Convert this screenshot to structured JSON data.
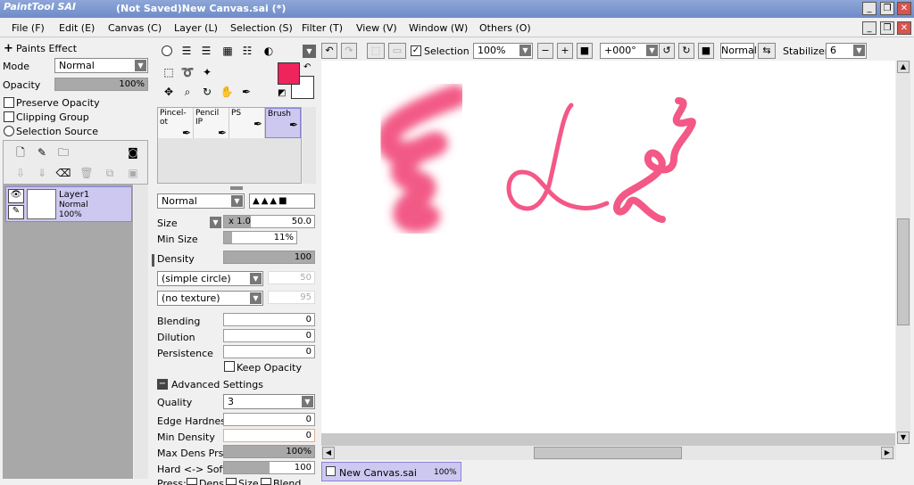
{
  "app": {
    "logo": "PaintTool SAI",
    "title": "(Not Saved)New Canvas.sai (*)"
  },
  "window": {
    "minimize": "_",
    "restore": "❐",
    "close": "✕"
  },
  "menu": [
    "File (F)",
    "Edit (E)",
    "Canvas (C)",
    "Layer (L)",
    "Selection (S)",
    "Filter (T)",
    "View (V)",
    "Window (W)",
    "Others (O)"
  ],
  "layer_panel": {
    "paints_effect": "Paints Effect",
    "mode_label": "Mode",
    "mode_value": "Normal",
    "opacity_label": "Opacity",
    "opacity_value": "100%",
    "opacity_fill": 1.0,
    "preserve_opacity": "Preserve Opacity",
    "clipping_group": "Clipping Group",
    "selection_source": "Selection Source",
    "layer": {
      "name": "Layer1",
      "mode": "Normal",
      "opacity": "100%"
    }
  },
  "tool_panel": {
    "tools": [
      "Pincel-ot",
      "Pencil IP",
      "PS",
      "Brush"
    ],
    "blend_mode": "Normal",
    "size_label": "Size",
    "size_mult": "x 1.0",
    "size_value": "50.0",
    "min_size_label": "Min Size",
    "min_size_value": "11%",
    "min_size_fill": 0.11,
    "density_label": "Density",
    "density_value": "100",
    "density_fill": 1.0,
    "shape": "(simple circle)",
    "shape_value": "50",
    "texture": "(no texture)",
    "texture_value": "95",
    "blending_label": "Blending",
    "blending_value": "0",
    "dilution_label": "Dilution",
    "dilution_value": "0",
    "persistence_label": "Persistence",
    "persistence_value": "0",
    "keep_opacity": "Keep Opacity",
    "advanced": "Advanced Settings",
    "quality_label": "Quality",
    "quality_value": "3",
    "edge_label": "Edge Hardness",
    "edge_value": "0",
    "min_density_label": "Min Density",
    "min_density_value": "0",
    "max_dens_label": "Max Dens Prs.",
    "max_dens_value": "100%",
    "max_dens_fill": 1.0,
    "hard_soft_label": "Hard <-> Soft",
    "hard_soft_value": "100",
    "hard_soft_fill": 0.5,
    "press_label": "Press:",
    "press_dens": "Dens",
    "press_size": "Size",
    "press_blend": "Blend"
  },
  "color": {
    "primary": "#f0245c",
    "secondary": "#ffffff"
  },
  "toolbar": {
    "selection": "Selection",
    "zoom": "100%",
    "rotation": "+000°",
    "blend": "Normal",
    "stabilizer_label": "Stabilizer",
    "stabilizer_value": "6"
  },
  "canvas_tab": {
    "name": "New Canvas.sai",
    "zoom": "100%"
  }
}
